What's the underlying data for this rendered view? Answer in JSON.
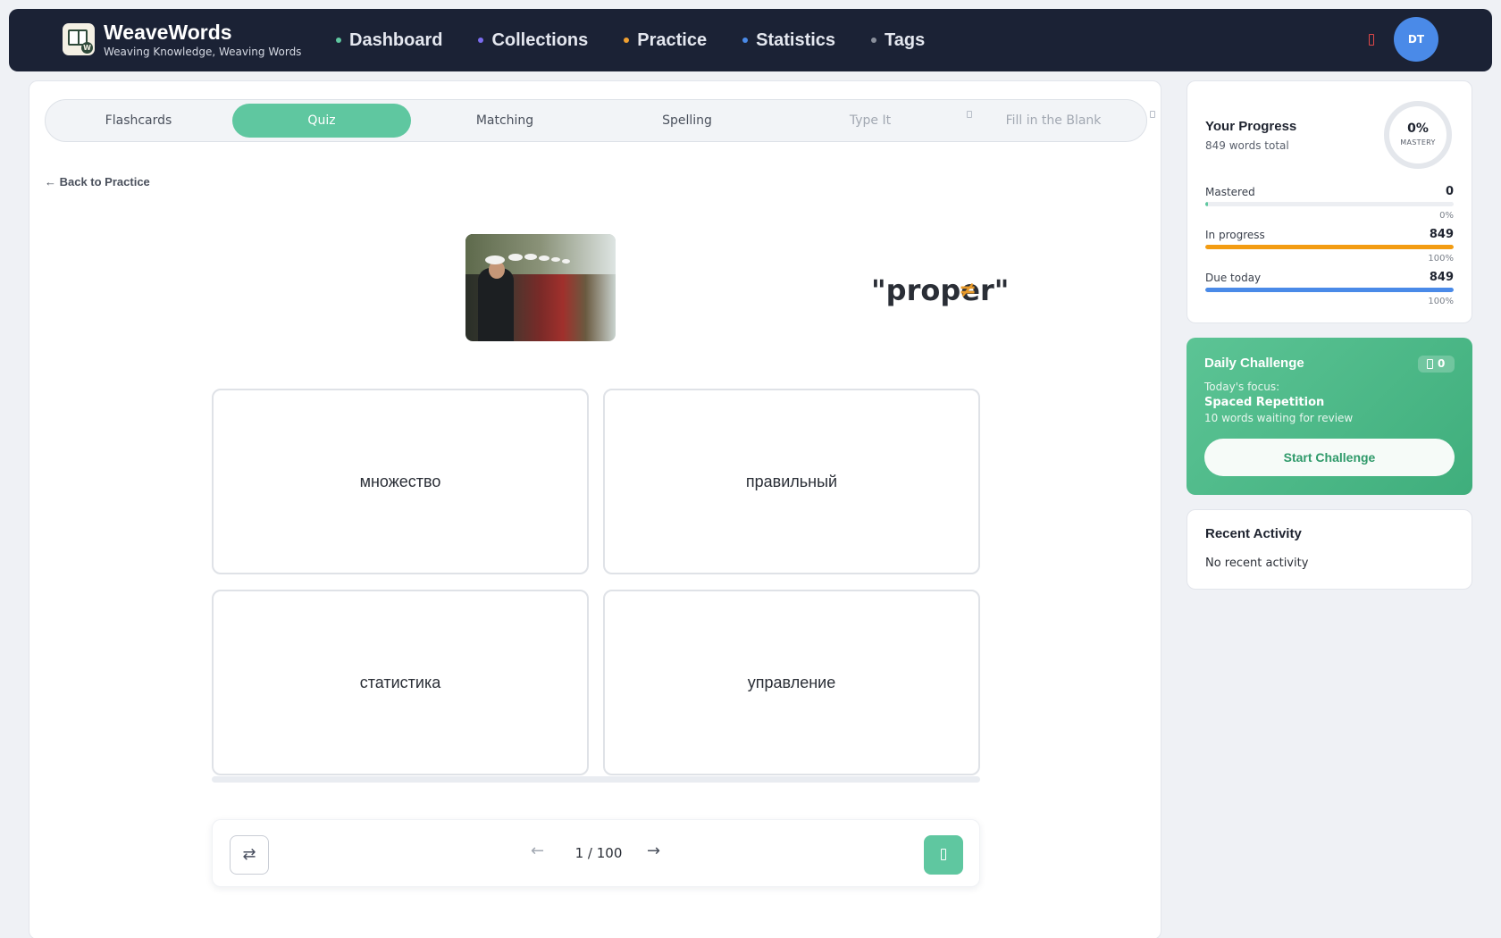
{
  "brand": {
    "title": "WeaveWords",
    "subtitle": "Weaving Knowledge, Weaving Words",
    "logo_icon": "book-icon"
  },
  "nav": {
    "items": [
      {
        "label": "Dashboard",
        "dot_color": "#5fc7a0"
      },
      {
        "label": "Collections",
        "dot_color": "#7b6cf0"
      },
      {
        "label": "Practice",
        "dot_color": "#f0a030"
      },
      {
        "label": "Statistics",
        "dot_color": "#4a8ae8"
      },
      {
        "label": "Tags",
        "dot_color": "#8a909c"
      }
    ],
    "notification_icon": "bell-icon",
    "avatar_initials": "DT"
  },
  "modes": {
    "items": [
      {
        "label": "Flashcards",
        "state": "default"
      },
      {
        "label": "Quiz",
        "state": "active"
      },
      {
        "label": "Matching",
        "state": "default"
      },
      {
        "label": "Spelling",
        "state": "default"
      },
      {
        "label": "Type It",
        "state": "locked"
      },
      {
        "label": "Fill in the Blank",
        "state": "locked"
      }
    ]
  },
  "quiz": {
    "back_label": "← Back to Practice",
    "term_open": "\"proper",
    "term_close": "\"",
    "answers": [
      "множество",
      "правильный",
      "статистика",
      "управление"
    ],
    "counter": "1 / 100",
    "prev_icon": "arrow-left-icon",
    "next_icon": "arrow-right-icon",
    "swap_icon": "swap-icon",
    "submit_icon": "lock-icon"
  },
  "progress": {
    "title": "Your Progress",
    "subtitle": "849 words total",
    "mastery_pct": "0%",
    "mastery_label": "MASTERY",
    "stats": [
      {
        "label": "Mastered",
        "value": "0",
        "pct_label": "0%",
        "fraction": 0.005,
        "color": "#5fc7a0"
      },
      {
        "label": "In progress",
        "value": "849",
        "pct_label": "100%",
        "fraction": 1.0,
        "color": "#f39c12"
      },
      {
        "label": "Due today",
        "value": "849",
        "pct_label": "100%",
        "fraction": 1.0,
        "color": "#4a8ae8"
      }
    ]
  },
  "challenge": {
    "title": "Daily Challenge",
    "badge": "0",
    "focus_label": "Today's focus:",
    "focus_name": "Spaced Repetition",
    "description": "10 words waiting for review",
    "button": "Start Challenge"
  },
  "activity": {
    "title": "Recent Activity",
    "empty": "No recent activity"
  }
}
